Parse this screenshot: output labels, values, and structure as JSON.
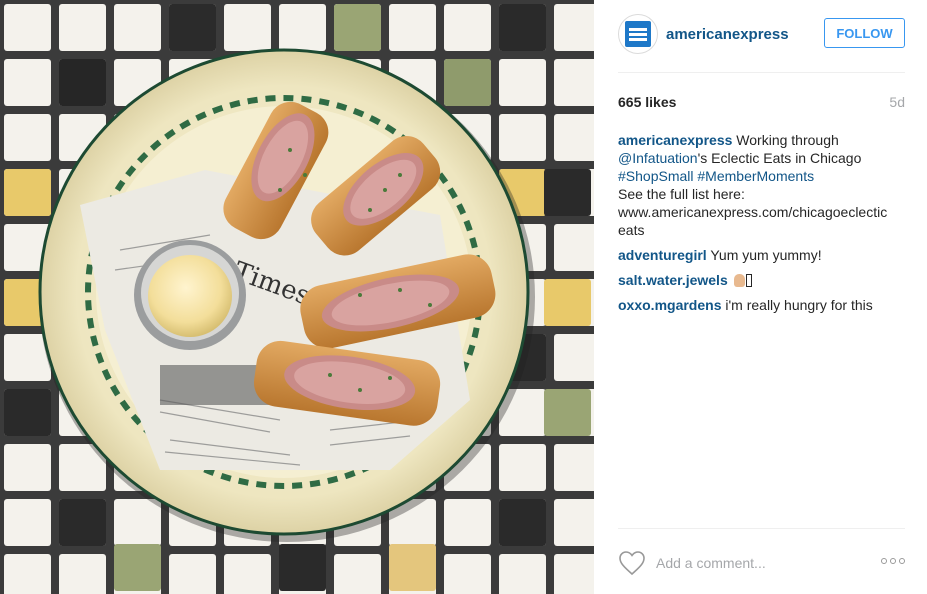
{
  "post": {
    "image_alt": "Plate of sliced egg rolls with dipping sauce on newspaper over a mosaic tile table"
  },
  "header": {
    "username": "americanexpress",
    "follow_label": "FOLLOW",
    "brand_color": "#1e78c8"
  },
  "meta": {
    "likes": "665 likes",
    "age": "5d"
  },
  "caption": {
    "user": "americanexpress",
    "text1": " Working through ",
    "mention": "@Infatuation",
    "text2": "'s Eclectic Eats in Chicago",
    "tag1": "#ShopSmall",
    "tag2": "#MemberMoments",
    "line3": "See the full list here:",
    "url": "www.americanexpress.com/chicagoeclectic eats"
  },
  "comments": [
    {
      "user": "adventuregirl",
      "text": " Yum yum yummy!"
    },
    {
      "user": "salt.water.jewels",
      "text": " "
    },
    {
      "user": "oxxo.mgardens",
      "text": " i'm really hungry for this"
    }
  ],
  "footer": {
    "comment_placeholder": "Add a comment..."
  },
  "icons": {
    "heart": "heart-icon",
    "more": "more-options-icon",
    "logo": "amex-logo-icon"
  }
}
